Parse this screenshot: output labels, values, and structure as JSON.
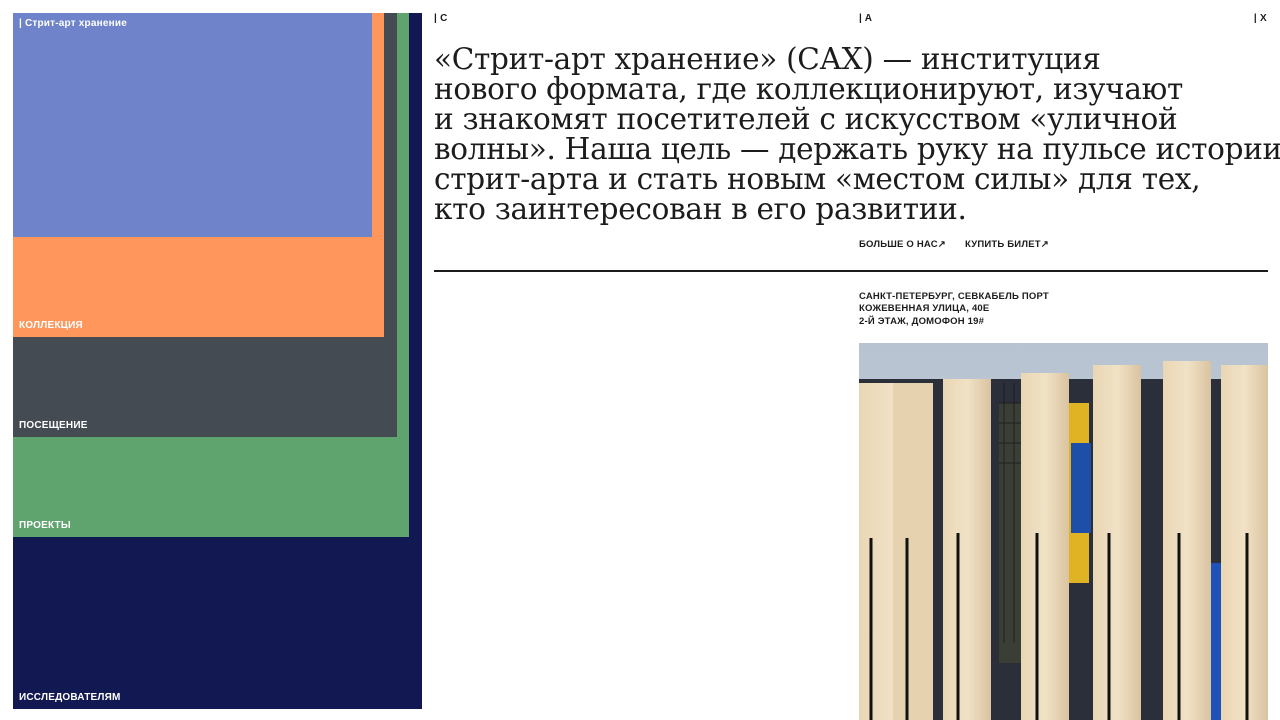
{
  "nav": {
    "home": "| Стрит-арт хранение",
    "collection": "КОЛЛЕКЦИЯ",
    "visit": "ПОСЕЩЕНИЕ",
    "projects": "ПРОЕКТЫ",
    "research": "ИССЛЕДОВАТЕЛЯМ"
  },
  "corners": {
    "c": "| C",
    "a": "| A",
    "x": "| X"
  },
  "intro": {
    "lines": [
      "«Стрит-арт хранение» (САХ) — институция",
      "нового формата, где коллекционируют, изучают",
      "и знакомят посетителей с искусством «уличной",
      "волны». Наша цель — держать руку на пульсе истории",
      "стрит-арта и стать новым «местом силы» для тех,",
      "кто заинтересован в его развитии."
    ]
  },
  "cta": {
    "about": "БОЛЬШЕ О НАС↗",
    "ticket": "КУПИТЬ БИЛЕТ↗"
  },
  "address": {
    "lines": [
      "САНКТ-ПЕТЕРБУРГ, СЕВКАБЕЛЬ ПОРТ",
      "КОЖЕВЕННАЯ УЛИЦА, 40Е",
      "2-Й ЭТАЖ, ДОМОФОН 19#"
    ]
  },
  "colors": {
    "home": "#6e83c9",
    "collection": "#ff965c",
    "visit": "#444b53",
    "projects": "#5fa46e",
    "research": "#121852"
  }
}
